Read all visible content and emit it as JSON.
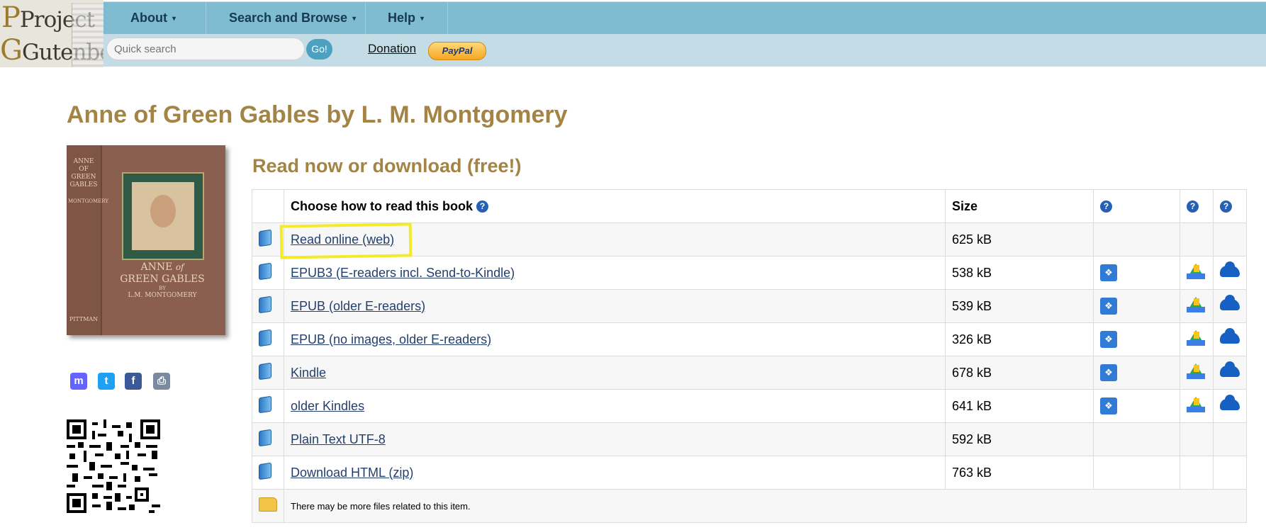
{
  "logo": {
    "line1": "Project",
    "line2": "Gutenberg"
  },
  "nav": {
    "items": [
      {
        "label": "About",
        "caret": "▾"
      },
      {
        "label": "Search and Browse",
        "caret": "▾"
      },
      {
        "label": "Help",
        "caret": "▾"
      }
    ],
    "search_placeholder": "Quick search",
    "go_label": "Go!",
    "donation_label": "Donation",
    "paypal_label": "PayPal"
  },
  "book": {
    "title": "Anne of Green Gables by L. M. Montgomery",
    "cover": {
      "spine_title": "ANNE OF GREEN GABLES",
      "spine_author": "MONTGOMERY",
      "spine_publisher": "PITTMAN",
      "front_title_1": "ANNE",
      "front_title_of": "of",
      "front_title_2": "GREEN GABLES",
      "front_by": "BY",
      "front_author": "L.M. MONTGOMERY"
    }
  },
  "share": [
    {
      "icon": "mastodon-icon",
      "glyph": "m",
      "color": "#6364ff"
    },
    {
      "icon": "twitter-icon",
      "glyph": "t",
      "color": "#1da1f2"
    },
    {
      "icon": "facebook-icon",
      "glyph": "f",
      "color": "#3b5998"
    },
    {
      "icon": "print-icon",
      "glyph": "⎙",
      "color": "#7a8aa0"
    }
  ],
  "downloads": {
    "heading": "Read now or download (free!)",
    "header": {
      "choose": "Choose how to read this book",
      "size": "Size",
      "help_glyph": "?"
    },
    "rows": [
      {
        "label": "Read online (web)",
        "size": "625 kB",
        "cloud": false
      },
      {
        "label": "EPUB3 (E-readers incl. Send-to-Kindle)",
        "size": "538 kB",
        "cloud": true
      },
      {
        "label": "EPUB (older E-readers)",
        "size": "539 kB",
        "cloud": true
      },
      {
        "label": "EPUB (no images, older E-readers)",
        "size": "326 kB",
        "cloud": true
      },
      {
        "label": "Kindle",
        "size": "678 kB",
        "cloud": true
      },
      {
        "label": "older Kindles",
        "size": "641 kB",
        "cloud": true
      },
      {
        "label": "Plain Text UTF-8",
        "size": "592 kB",
        "cloud": false
      },
      {
        "label": "Download HTML (zip)",
        "size": "763 kB",
        "cloud": false
      }
    ],
    "more_files_note": "There may be more files related to this item."
  },
  "colors": {
    "nav_bar": "#7fbcd2",
    "sub_bar": "#c4dce5",
    "title_gold": "#a48445",
    "highlight": "#f4ea2a"
  }
}
